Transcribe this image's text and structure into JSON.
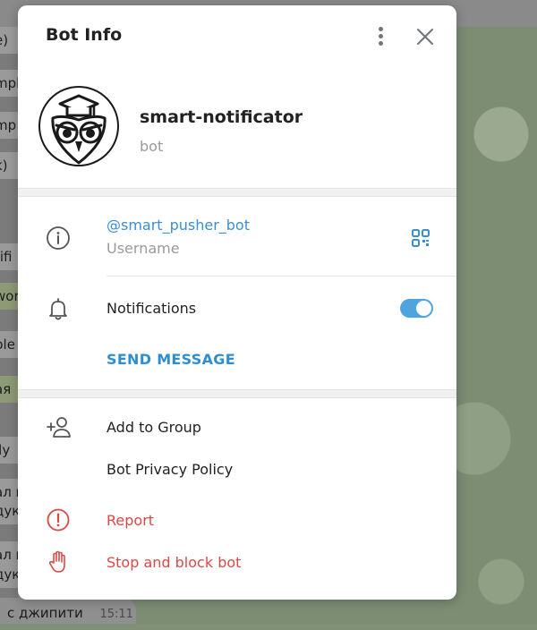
{
  "background": {
    "snippets": [
      "e)",
      "mple",
      "mp",
      "k)",
      "tifi",
      "wor",
      "ple",
      "ая",
      "lly",
      "ал н",
      "дук",
      "ал н",
      "дук"
    ],
    "bottom_message": "с джипити",
    "bottom_time": "15:11"
  },
  "dialog": {
    "title": "Bot Info",
    "bot_name": "smart-notificator",
    "bot_subtitle": "bot",
    "username": "@smart_pusher_bot",
    "username_caption": "Username",
    "notifications_label": "Notifications",
    "notifications_enabled": true,
    "send_message_label": "SEND MESSAGE",
    "add_to_group_label": "Add to Group",
    "privacy_policy_label": "Bot Privacy Policy",
    "report_label": "Report",
    "stop_block_label": "Stop and block bot"
  },
  "colors": {
    "accent": "#3a8fd0",
    "danger": "#d94a45",
    "toggle_on": "#4ea4de"
  },
  "icons": [
    "more-vertical-icon",
    "close-icon",
    "owl-avatar",
    "info-icon",
    "qr-code-icon",
    "bell-icon",
    "add-user-icon",
    "report-icon",
    "block-hand-icon"
  ]
}
